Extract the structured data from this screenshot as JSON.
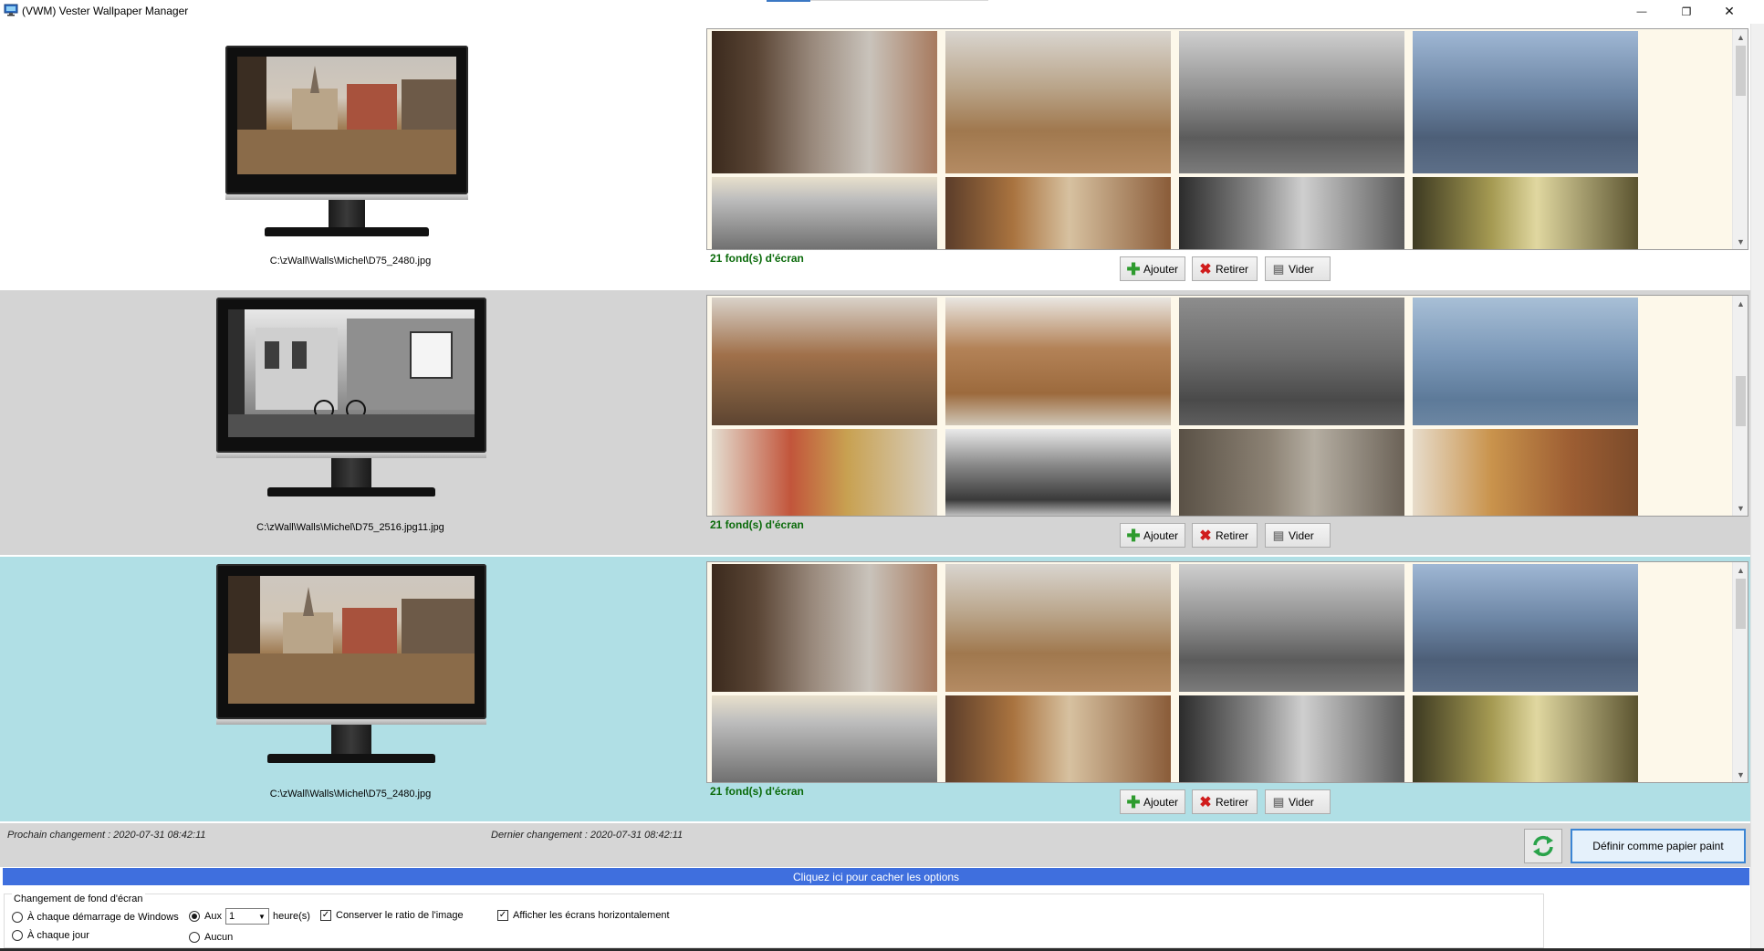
{
  "window": {
    "title": "(VWM) Vester Wallpaper Manager",
    "minimize_glyph": "—",
    "restore_glyph": "❐",
    "close_glyph": "✕"
  },
  "screens": [
    {
      "path": "C:\\zWall\\Walls\\Michel\\D75_2480.jpg",
      "count_label": "21 fond(s) d'écran"
    },
    {
      "path": "C:\\zWall\\Walls\\Michel\\D75_2516.jpg11.jpg",
      "count_label": "21 fond(s) d'écran"
    },
    {
      "path": "C:\\zWall\\Walls\\Michel\\D75_2480.jpg",
      "count_label": "21 fond(s) d'écran"
    }
  ],
  "buttons": {
    "add": "Ajouter",
    "remove": "Retirer",
    "clear": "Vider",
    "set_wallpaper": "Définir comme papier paint"
  },
  "status": {
    "next_change": "Prochain changement : 2020-07-31 08:42:11",
    "last_change": "Dernier changement : 2020-07-31 08:42:11"
  },
  "options": {
    "toggle_bar": "Cliquez ici pour cacher les options",
    "group_title": "Changement de fond d'écran",
    "on_startup": "À chaque démarrage de Windows",
    "daily": "À chaque jour",
    "every_prefix": "Aux",
    "every_value": "1",
    "every_unit": "heure(s)",
    "none": "Aucun",
    "keep_ratio": "Conserver le ratio de l'image",
    "horizontal": "Afficher les écrans horizontalement",
    "selected_interval": "every",
    "keep_ratio_checked": true,
    "horizontal_checked": true
  },
  "icons": {
    "app": "monitor-icon",
    "add": "green-plus-icon",
    "remove": "red-x-icon",
    "clear": "clipboard-icon",
    "refresh": "refresh-arrows-icon"
  },
  "colors": {
    "row2_bg": "#d4d4d4",
    "row3_bg": "#b0dfe5",
    "count_text": "#0b6b0b",
    "options_bar": "#3f6fde",
    "set_button_border": "#3b85d4"
  }
}
